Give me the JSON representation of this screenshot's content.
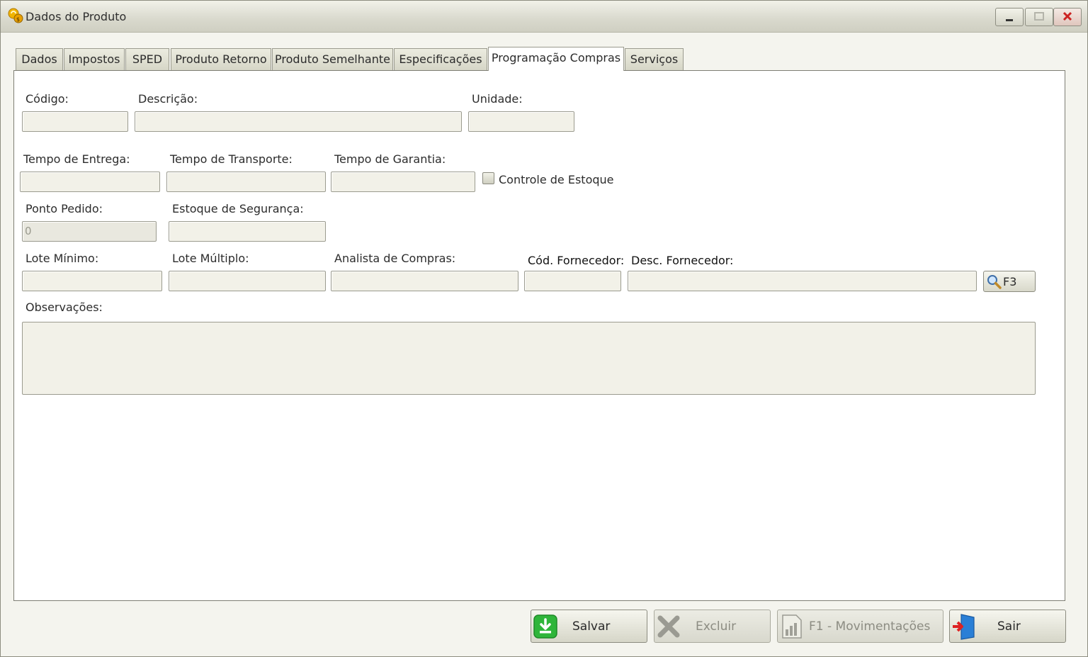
{
  "window": {
    "title": "Dados do Produto"
  },
  "tabs": [
    {
      "label": "Dados"
    },
    {
      "label": "Impostos"
    },
    {
      "label": "SPED"
    },
    {
      "label": "Produto Retorno"
    },
    {
      "label": "Produto Semelhante"
    },
    {
      "label": "Especificações"
    },
    {
      "label": "Programação Compras"
    },
    {
      "label": "Serviços"
    }
  ],
  "active_tab": "Programação Compras",
  "form": {
    "codigo": {
      "label": "Código:",
      "value": ""
    },
    "descricao": {
      "label": "Descrição:",
      "value": ""
    },
    "unidade": {
      "label": "Unidade:",
      "value": ""
    },
    "tempo_entrega": {
      "label": "Tempo de Entrega:",
      "value": ""
    },
    "tempo_transporte": {
      "label": "Tempo de Transporte:",
      "value": ""
    },
    "tempo_garantia": {
      "label": "Tempo de Garantia:",
      "value": ""
    },
    "controle_estoque": {
      "label": "Controle de Estoque",
      "checked": false
    },
    "ponto_pedido": {
      "label": "Ponto Pedido:",
      "value": "0"
    },
    "estoque_seguranca": {
      "label": "Estoque de Segurança:",
      "value": ""
    },
    "lote_minimo": {
      "label": "Lote Mínimo:",
      "value": ""
    },
    "lote_multiplo": {
      "label": "Lote Múltiplo:",
      "value": ""
    },
    "analista_compras": {
      "label": "Analista de Compras:",
      "value": ""
    },
    "cod_fornecedor": {
      "label": "Cód. Fornecedor:",
      "value": ""
    },
    "desc_fornecedor": {
      "label": "Desc. Fornecedor:",
      "value": ""
    },
    "search_button": {
      "label": "F3",
      "icon": "magnifier-icon"
    },
    "observacoes": {
      "label": "Observações:",
      "value": ""
    }
  },
  "actions": {
    "salvar": {
      "label": "Salvar",
      "icon": "download-green-icon",
      "enabled": true
    },
    "excluir": {
      "label": "Excluir",
      "icon": "x-gray-icon",
      "enabled": false
    },
    "movimentacoes": {
      "label": "F1 - Movimentações",
      "icon": "report-chart-icon",
      "enabled": false
    },
    "sair": {
      "label": "Sair",
      "icon": "exit-door-icon",
      "enabled": true
    }
  },
  "colors": {
    "accent_green": "#2fb53a",
    "close_red": "#cc2222",
    "exit_blue": "#2a7fd6"
  }
}
